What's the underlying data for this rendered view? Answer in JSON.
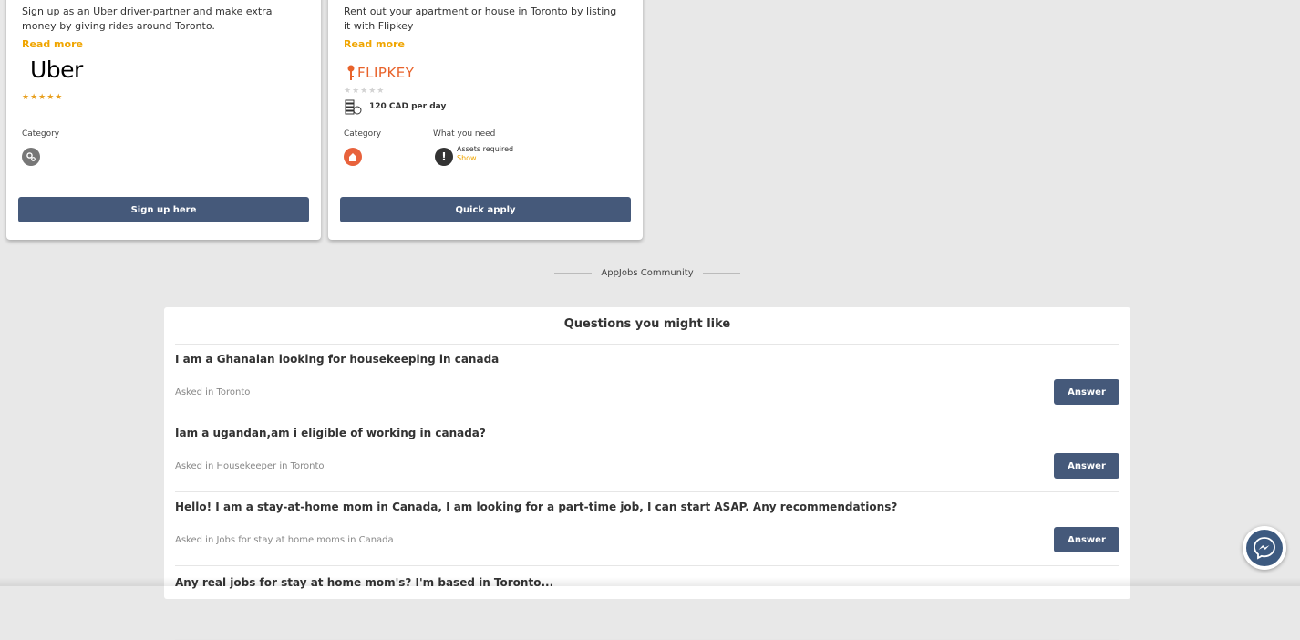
{
  "cards": [
    {
      "description": "Sign up as an Uber driver-partner and make extra money by giving rides around Toronto.",
      "read_more": "Read more",
      "logo_text": "Uber",
      "rating_stars": "★★★★★",
      "rating": 5,
      "category_label": "Category",
      "category_icon": "gears-icon",
      "button_label": "Sign up here"
    },
    {
      "description": "Rent out your apartment or house in Toronto by listing it with Flipkey",
      "read_more": "Read more",
      "logo_text": "FLIPKEY",
      "rating_stars": "★★★★★",
      "rating": 0,
      "pay": "120 CAD per day",
      "category_label": "Category",
      "category_icon": "house-icon",
      "need_label": "What you need",
      "need_text": "Assets required",
      "need_show": "Show",
      "button_label": "Quick apply"
    }
  ],
  "community": {
    "label": "AppJobs Community",
    "panel_title": "Questions you might like",
    "questions": [
      {
        "text": "I am a Ghanaian looking for housekeeping in canada",
        "meta": "Asked in Toronto",
        "button": "Answer"
      },
      {
        "text": "Iam a ugandan,am i eligible of working in canada?",
        "meta": "Asked in Housekeeper in Toronto",
        "button": "Answer"
      },
      {
        "text": "Hello! I am a stay-at-home mom in Canada, I am looking for a part-time job, I can start ASAP. Any recommendations?",
        "meta": "Asked in Jobs for stay at home moms in Canada",
        "button": "Answer"
      },
      {
        "text": "Any real jobs for stay at home mom's? I'm based in Toronto..."
      }
    ]
  },
  "colors": {
    "accent": "#f0a500",
    "button": "#45597a",
    "background": "#e8e8e8"
  },
  "messenger_icon": "messenger-icon"
}
